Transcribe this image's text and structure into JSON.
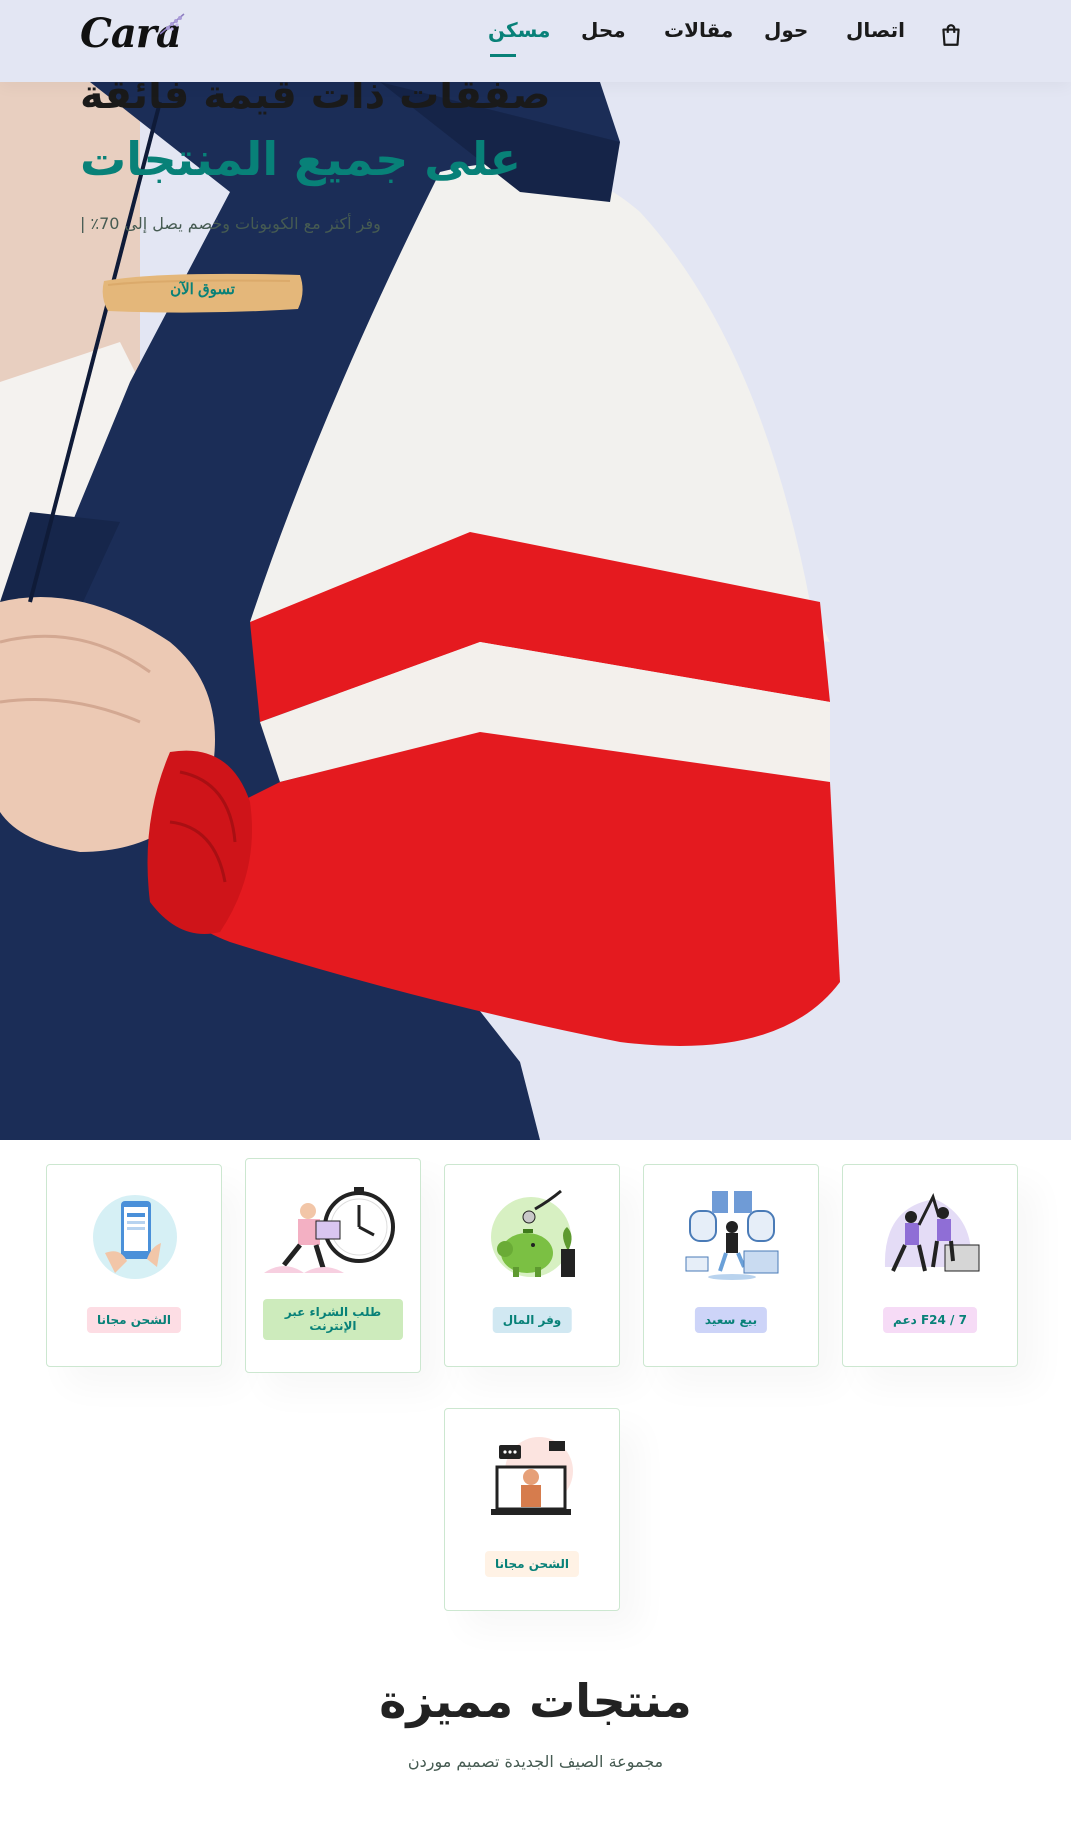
{
  "brand": {
    "logo_text": "Cara"
  },
  "nav": {
    "items": [
      {
        "label": "مسكن",
        "active": true
      },
      {
        "label": "محل",
        "active": false
      },
      {
        "label": "مقالات",
        "active": false
      },
      {
        "label": "حول",
        "active": false
      },
      {
        "label": "اتصال",
        "active": false
      }
    ],
    "cart_icon": "shopping-bag-icon"
  },
  "hero": {
    "heading_line1": "صفقات ذات قيمة فائقة",
    "heading_line2": "على جميع المنتجات",
    "subtitle": "وفر أكثر مع الكوبونات وخصم يصل إلى 70٪ |",
    "button_label": "تسوق الآن"
  },
  "features": [
    {
      "label": "الشحن مجانا",
      "badge_color": "#fddde4",
      "icon": "mobile-payment-icon"
    },
    {
      "label": "طلب الشراء عبر الإنترنت",
      "badge_color": "#cdebbc",
      "icon": "online-order-icon"
    },
    {
      "label": "وفر المال",
      "badge_color": "#d1e8f2",
      "icon": "piggy-bank-icon"
    },
    {
      "label": "بيع سعيد",
      "badge_color": "#cdd4f8",
      "icon": "happy-sale-icon"
    },
    {
      "label": "F24 / 7 دعم",
      "badge_color": "#f6dbf6",
      "icon": "support-icon"
    },
    {
      "label": "الشحن مجانا",
      "badge_color": "#fff2e5",
      "icon": "laptop-support-icon"
    }
  ],
  "featured": {
    "title": "منتجات مميزة",
    "subtitle": "مجموعة الصيف الجديدة تصميم موردن"
  },
  "colors": {
    "primary": "#088178",
    "hero_bg": "#e3e6f3",
    "text_dark": "#222222"
  }
}
